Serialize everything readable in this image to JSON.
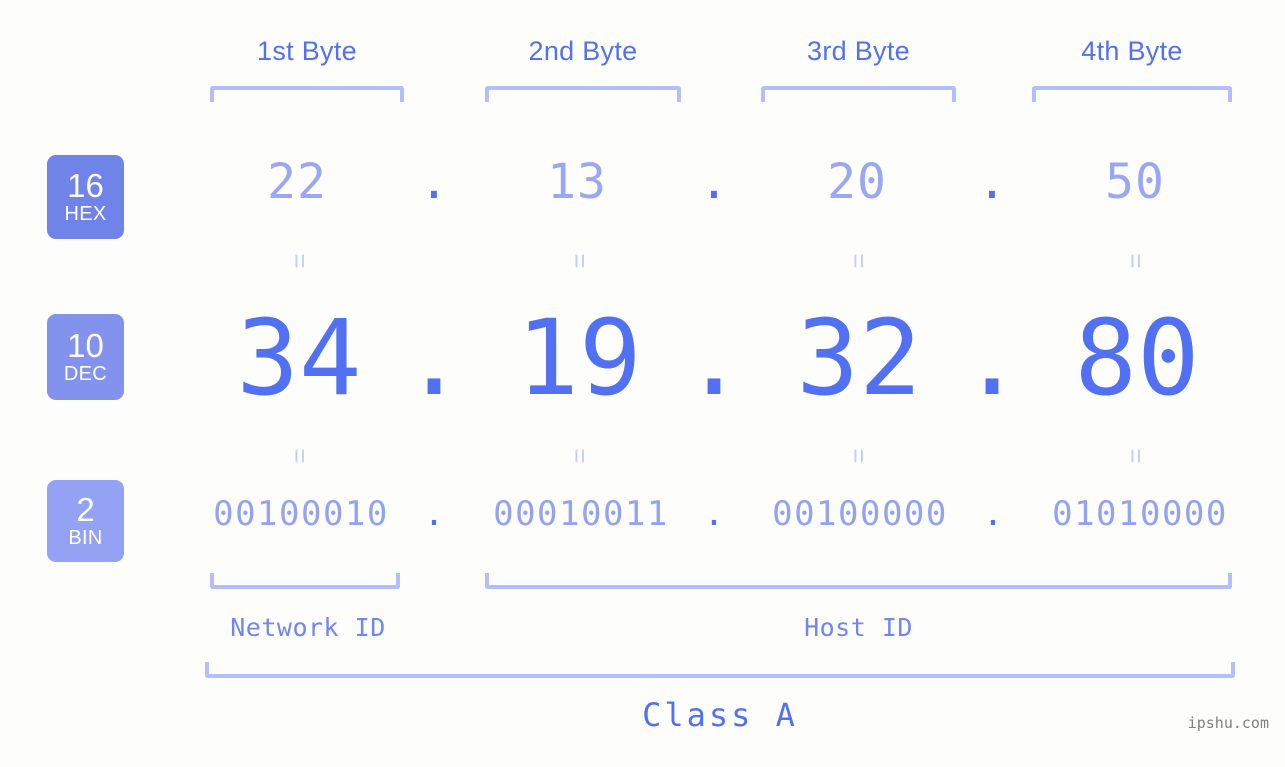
{
  "meta": {
    "watermark": "ipshu.com",
    "background_color": "#fdfefb",
    "accent_strong": "#5271f2",
    "accent_mid": "#8392ec",
    "accent_light": "#b3bffb"
  },
  "byte_headers": [
    {
      "label": "1st Byte"
    },
    {
      "label": "2nd Byte"
    },
    {
      "label": "3rd Byte"
    },
    {
      "label": "4th Byte"
    }
  ],
  "rows": [
    {
      "badge_number": "16",
      "badge_name": "HEX",
      "badge_color": "#7083e8",
      "values": [
        "22",
        "13",
        "20",
        "50"
      ],
      "separator": "."
    },
    {
      "badge_number": "10",
      "badge_name": "DEC",
      "badge_color": "#8392ec",
      "values": [
        "34",
        "19",
        "32",
        "80"
      ],
      "separator": "."
    },
    {
      "badge_number": "2",
      "badge_name": "BIN",
      "badge_color": "#93a2f2",
      "values": [
        "00100010",
        "00010011",
        "00100000",
        "01010000"
      ],
      "separator": "."
    }
  ],
  "equals_marks": {
    "glyph": "=",
    "count_per_row": 4
  },
  "id_sections": [
    {
      "label": "Network ID"
    },
    {
      "label": "Host ID"
    }
  ],
  "class_label": "Class A"
}
